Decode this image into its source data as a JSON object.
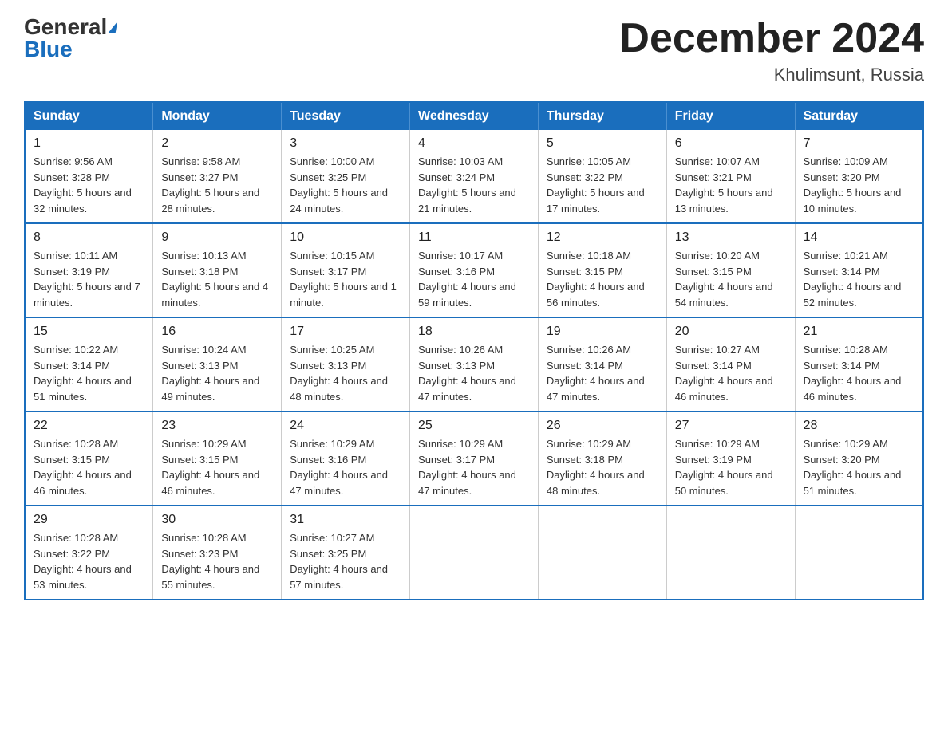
{
  "logo": {
    "general": "General",
    "blue": "Blue"
  },
  "title": "December 2024",
  "location": "Khulimsunt, Russia",
  "days_of_week": [
    "Sunday",
    "Monday",
    "Tuesday",
    "Wednesday",
    "Thursday",
    "Friday",
    "Saturday"
  ],
  "weeks": [
    [
      {
        "day": "1",
        "sunrise": "9:56 AM",
        "sunset": "3:28 PM",
        "daylight": "5 hours and 32 minutes."
      },
      {
        "day": "2",
        "sunrise": "9:58 AM",
        "sunset": "3:27 PM",
        "daylight": "5 hours and 28 minutes."
      },
      {
        "day": "3",
        "sunrise": "10:00 AM",
        "sunset": "3:25 PM",
        "daylight": "5 hours and 24 minutes."
      },
      {
        "day": "4",
        "sunrise": "10:03 AM",
        "sunset": "3:24 PM",
        "daylight": "5 hours and 21 minutes."
      },
      {
        "day": "5",
        "sunrise": "10:05 AM",
        "sunset": "3:22 PM",
        "daylight": "5 hours and 17 minutes."
      },
      {
        "day": "6",
        "sunrise": "10:07 AM",
        "sunset": "3:21 PM",
        "daylight": "5 hours and 13 minutes."
      },
      {
        "day": "7",
        "sunrise": "10:09 AM",
        "sunset": "3:20 PM",
        "daylight": "5 hours and 10 minutes."
      }
    ],
    [
      {
        "day": "8",
        "sunrise": "10:11 AM",
        "sunset": "3:19 PM",
        "daylight": "5 hours and 7 minutes."
      },
      {
        "day": "9",
        "sunrise": "10:13 AM",
        "sunset": "3:18 PM",
        "daylight": "5 hours and 4 minutes."
      },
      {
        "day": "10",
        "sunrise": "10:15 AM",
        "sunset": "3:17 PM",
        "daylight": "5 hours and 1 minute."
      },
      {
        "day": "11",
        "sunrise": "10:17 AM",
        "sunset": "3:16 PM",
        "daylight": "4 hours and 59 minutes."
      },
      {
        "day": "12",
        "sunrise": "10:18 AM",
        "sunset": "3:15 PM",
        "daylight": "4 hours and 56 minutes."
      },
      {
        "day": "13",
        "sunrise": "10:20 AM",
        "sunset": "3:15 PM",
        "daylight": "4 hours and 54 minutes."
      },
      {
        "day": "14",
        "sunrise": "10:21 AM",
        "sunset": "3:14 PM",
        "daylight": "4 hours and 52 minutes."
      }
    ],
    [
      {
        "day": "15",
        "sunrise": "10:22 AM",
        "sunset": "3:14 PM",
        "daylight": "4 hours and 51 minutes."
      },
      {
        "day": "16",
        "sunrise": "10:24 AM",
        "sunset": "3:13 PM",
        "daylight": "4 hours and 49 minutes."
      },
      {
        "day": "17",
        "sunrise": "10:25 AM",
        "sunset": "3:13 PM",
        "daylight": "4 hours and 48 minutes."
      },
      {
        "day": "18",
        "sunrise": "10:26 AM",
        "sunset": "3:13 PM",
        "daylight": "4 hours and 47 minutes."
      },
      {
        "day": "19",
        "sunrise": "10:26 AM",
        "sunset": "3:14 PM",
        "daylight": "4 hours and 47 minutes."
      },
      {
        "day": "20",
        "sunrise": "10:27 AM",
        "sunset": "3:14 PM",
        "daylight": "4 hours and 46 minutes."
      },
      {
        "day": "21",
        "sunrise": "10:28 AM",
        "sunset": "3:14 PM",
        "daylight": "4 hours and 46 minutes."
      }
    ],
    [
      {
        "day": "22",
        "sunrise": "10:28 AM",
        "sunset": "3:15 PM",
        "daylight": "4 hours and 46 minutes."
      },
      {
        "day": "23",
        "sunrise": "10:29 AM",
        "sunset": "3:15 PM",
        "daylight": "4 hours and 46 minutes."
      },
      {
        "day": "24",
        "sunrise": "10:29 AM",
        "sunset": "3:16 PM",
        "daylight": "4 hours and 47 minutes."
      },
      {
        "day": "25",
        "sunrise": "10:29 AM",
        "sunset": "3:17 PM",
        "daylight": "4 hours and 47 minutes."
      },
      {
        "day": "26",
        "sunrise": "10:29 AM",
        "sunset": "3:18 PM",
        "daylight": "4 hours and 48 minutes."
      },
      {
        "day": "27",
        "sunrise": "10:29 AM",
        "sunset": "3:19 PM",
        "daylight": "4 hours and 50 minutes."
      },
      {
        "day": "28",
        "sunrise": "10:29 AM",
        "sunset": "3:20 PM",
        "daylight": "4 hours and 51 minutes."
      }
    ],
    [
      {
        "day": "29",
        "sunrise": "10:28 AM",
        "sunset": "3:22 PM",
        "daylight": "4 hours and 53 minutes."
      },
      {
        "day": "30",
        "sunrise": "10:28 AM",
        "sunset": "3:23 PM",
        "daylight": "4 hours and 55 minutes."
      },
      {
        "day": "31",
        "sunrise": "10:27 AM",
        "sunset": "3:25 PM",
        "daylight": "4 hours and 57 minutes."
      },
      null,
      null,
      null,
      null
    ]
  ],
  "labels": {
    "sunrise": "Sunrise:",
    "sunset": "Sunset:",
    "daylight": "Daylight:"
  }
}
